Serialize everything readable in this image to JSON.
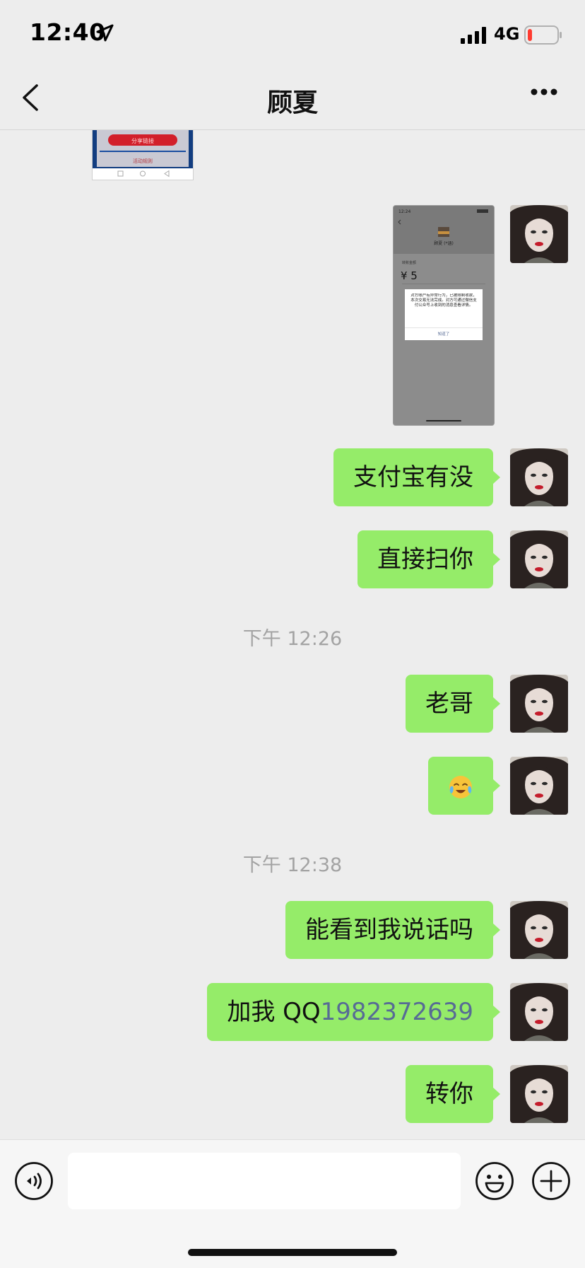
{
  "status_bar": {
    "time": "12:40",
    "network": "4G",
    "battery_color": "#ff3b30"
  },
  "nav": {
    "title": "顾夏",
    "back_icon": "chevron-left-icon",
    "more_icon": "more-dots-icon"
  },
  "messages": [
    {
      "type": "image",
      "sender": "self",
      "description_icon": "screenshot-thumbnail"
    },
    {
      "type": "text",
      "sender": "self",
      "text": "支付宝有没"
    },
    {
      "type": "text",
      "sender": "self",
      "text": "直接扫你"
    },
    {
      "type": "timestamp",
      "text": "下午 12:26"
    },
    {
      "type": "text",
      "sender": "self",
      "text": "老哥"
    },
    {
      "type": "emoji",
      "sender": "self",
      "text": "😭"
    },
    {
      "type": "timestamp",
      "text": "下午 12:38"
    },
    {
      "type": "text",
      "sender": "self",
      "text": "能看到我说话吗"
    },
    {
      "type": "text",
      "sender": "self",
      "prefix": "加我 QQ",
      "link": "1982372639"
    },
    {
      "type": "text",
      "sender": "self",
      "text": "转你"
    }
  ],
  "screenshot": {
    "time": "12:24",
    "name": "顾夏 (*涵)",
    "label": "转账金额",
    "amount": "¥ 5",
    "dialog_text": "对方账户有异常行为，已被限制收款，本次交易无法完成。对方可通过微信支付公众号上收到的消息查看详情。",
    "dialog_button": "知道了"
  },
  "partial_image": {
    "button_text": "分享链接",
    "sub_text": "活动规则"
  },
  "input_bar": {
    "placeholder": "",
    "voice_icon": "voice-icon",
    "emoji_icon": "emoji-icon",
    "plus_icon": "plus-icon"
  },
  "colors": {
    "bubble": "#95ec69",
    "link": "#576b95",
    "background": "#ededed"
  }
}
